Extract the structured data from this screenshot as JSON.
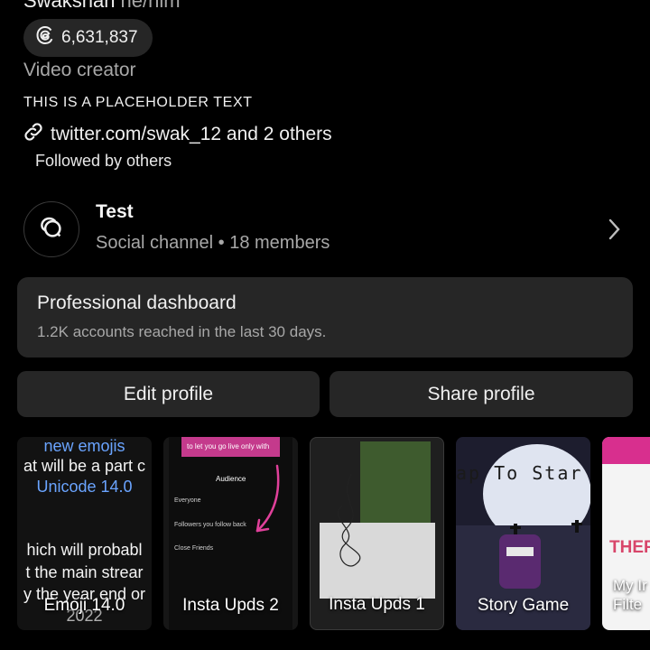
{
  "profile": {
    "name": "Swakshan",
    "pronouns": "he/him",
    "threads_count": "6,631,837",
    "category": "Video creator",
    "bio": "THIS IS A PLACEHOLDER TEXT",
    "link": "twitter.com/swak_12 and 2 others",
    "followed_by": "Followed by others",
    "icons": {
      "threads": "threads-icon",
      "link": "link-icon"
    }
  },
  "channel": {
    "title": "Test",
    "subtitle": "Social channel • 18 members",
    "icon": "chat-bubble-icon",
    "chevron": "chevron-right-icon"
  },
  "dashboard": {
    "title": "Professional dashboard",
    "subtitle": "1.2K accounts reached in the last 30 days."
  },
  "actions": {
    "edit": "Edit profile",
    "share": "Share profile"
  },
  "highlights": [
    {
      "label": "Emoji 14.0",
      "thumb_lines": [
        "new emojis",
        "at will be a part c",
        "Unicode 14.0",
        "hich will probabl",
        "t the main strear",
        "y the year end or",
        "2022"
      ]
    },
    {
      "label": "Insta Upds 2",
      "thumb_lines": [
        "to let you go live only with",
        "Audience",
        "Everyone",
        "Followers you follow back",
        "Close Friends"
      ]
    },
    {
      "label": "Insta Upds 1"
    },
    {
      "label": "Story Game",
      "thumb_lines": [
        "ap To Star"
      ]
    },
    {
      "label": "My Ir Filte",
      "label_lines": [
        "My Ir",
        "Filte"
      ],
      "thumb_lines": [
        "THER"
      ]
    }
  ],
  "colors": {
    "background": "#000000",
    "surface": "#262626",
    "text_secondary": "#a8a8a8",
    "emoji_blue": "#6aa4ff",
    "accent_pink": "#d82f8e"
  }
}
